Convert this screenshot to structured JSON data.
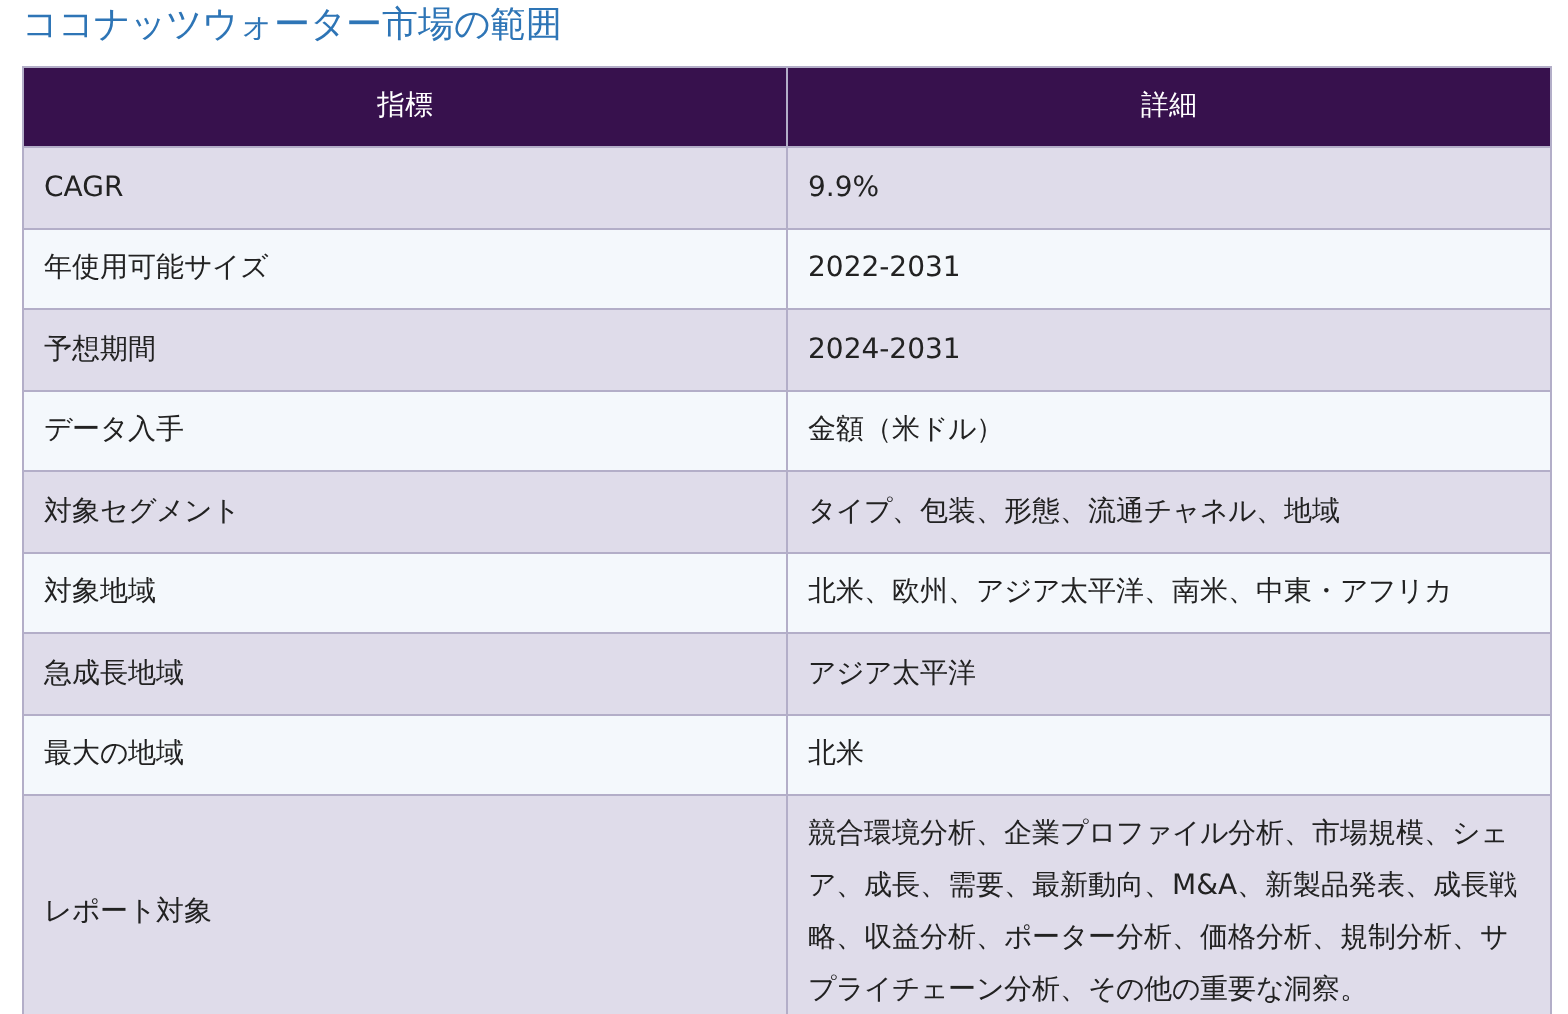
{
  "title": "ココナッツウォーター市場の範囲",
  "table": {
    "columns": [
      "指標",
      "詳細"
    ],
    "rows": [
      [
        "CAGR",
        "9.9%"
      ],
      [
        "年使用可能サイズ",
        "2022-2031"
      ],
      [
        "予想期間",
        "2024-2031"
      ],
      [
        "データ入手",
        "金額（米ドル）"
      ],
      [
        "対象セグメント",
        "タイプ、包装、形態、流通チャネル、地域"
      ],
      [
        "対象地域",
        "北米、欧州、アジア太平洋、南米、中東・アフリカ"
      ],
      [
        "急成長地域",
        "アジア太平洋"
      ],
      [
        "最大の地域",
        "北米"
      ],
      [
        "レポート対象",
        "競合環境分析、企業プロファイル分析、市場規模、シェア、成長、需要、最新動向、M&A、新製品発表、成長戦略、収益分析、ポーター分析、価格分析、規制分析、サプライチェーン分析、その他の重要な洞察。"
      ]
    ]
  }
}
